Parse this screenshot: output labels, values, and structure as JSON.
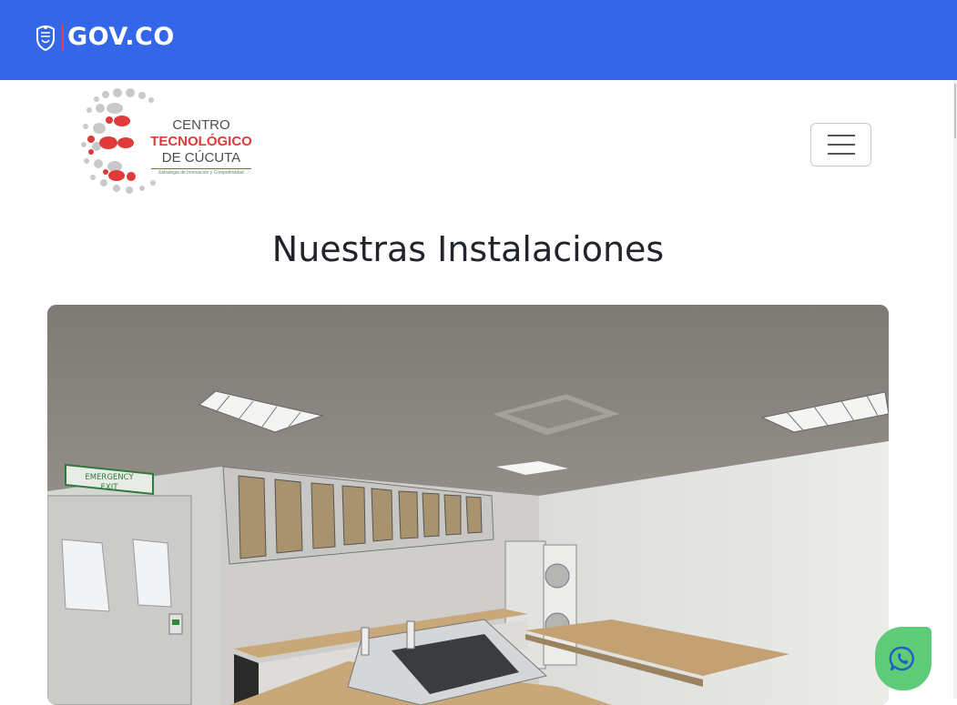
{
  "gov_bar": {
    "logo_text": "GOV.CO",
    "icon": "colombia-shield-icon",
    "color": "#3366e8"
  },
  "brand": {
    "line1": "CENTRO",
    "line2": "TECNOLÓGICO",
    "line3": "DE CÚCUTA",
    "tagline": "Estrategia de Innovación y Competitividad",
    "accent_color": "#e03a3a"
  },
  "nav": {
    "toggler_icon": "hamburger-menu-icon"
  },
  "main": {
    "title": "Nuestras Instalaciones",
    "hero_image": {
      "sign_text_line1": "EMERGENCY",
      "sign_text_line2": "EXIT"
    }
  },
  "floating": {
    "whatsapp_icon": "whatsapp-icon",
    "whatsapp_color": "#5ecb78"
  }
}
